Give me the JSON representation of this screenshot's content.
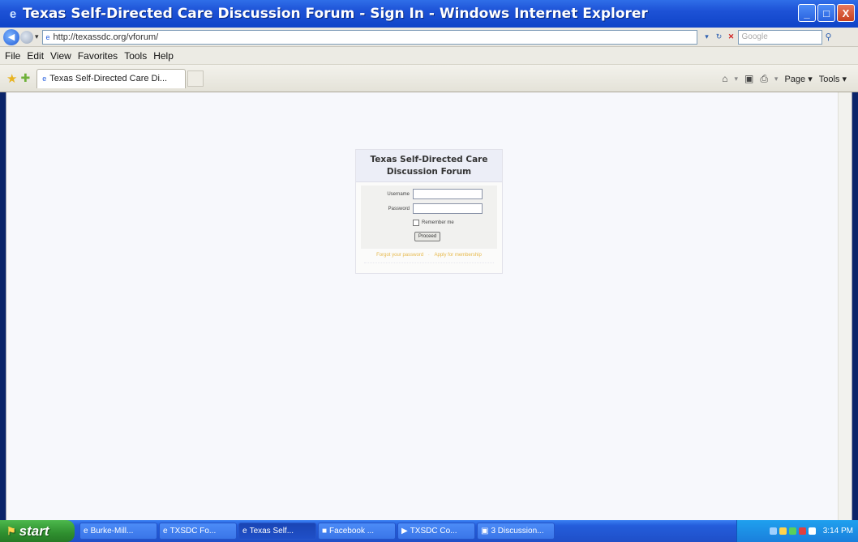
{
  "window": {
    "title": "Texas Self-Directed Care Discussion Forum - Sign In - Windows Internet Explorer",
    "controls": {
      "minimize": "_",
      "maximize": "□",
      "close": "X"
    }
  },
  "address_bar": {
    "url": "http://texassdc.org/vforum/",
    "search_placeholder": "Google"
  },
  "menu": [
    "File",
    "Edit",
    "View",
    "Favorites",
    "Tools",
    "Help"
  ],
  "tab": {
    "label": "Texas Self-Directed Care Di..."
  },
  "command_bar": {
    "page": "Page ▾",
    "tools": "Tools ▾"
  },
  "login": {
    "title_line1": "Texas Self-Directed Care",
    "title_line2": "Discussion Forum",
    "username_label": "Username",
    "password_label": "Password",
    "remember_label": "Remember me",
    "proceed_label": "Proceed",
    "forgot_link": "Forgot your password",
    "apply_link": "Apply for membership"
  },
  "taskbar": {
    "start": "start",
    "tasks": [
      "Burke-Mill...",
      "TXSDC Fo...",
      "Texas Self...",
      "Facebook ...",
      "TXSDC Co...",
      "3 Discussion..."
    ],
    "clock": "3:14 PM"
  }
}
